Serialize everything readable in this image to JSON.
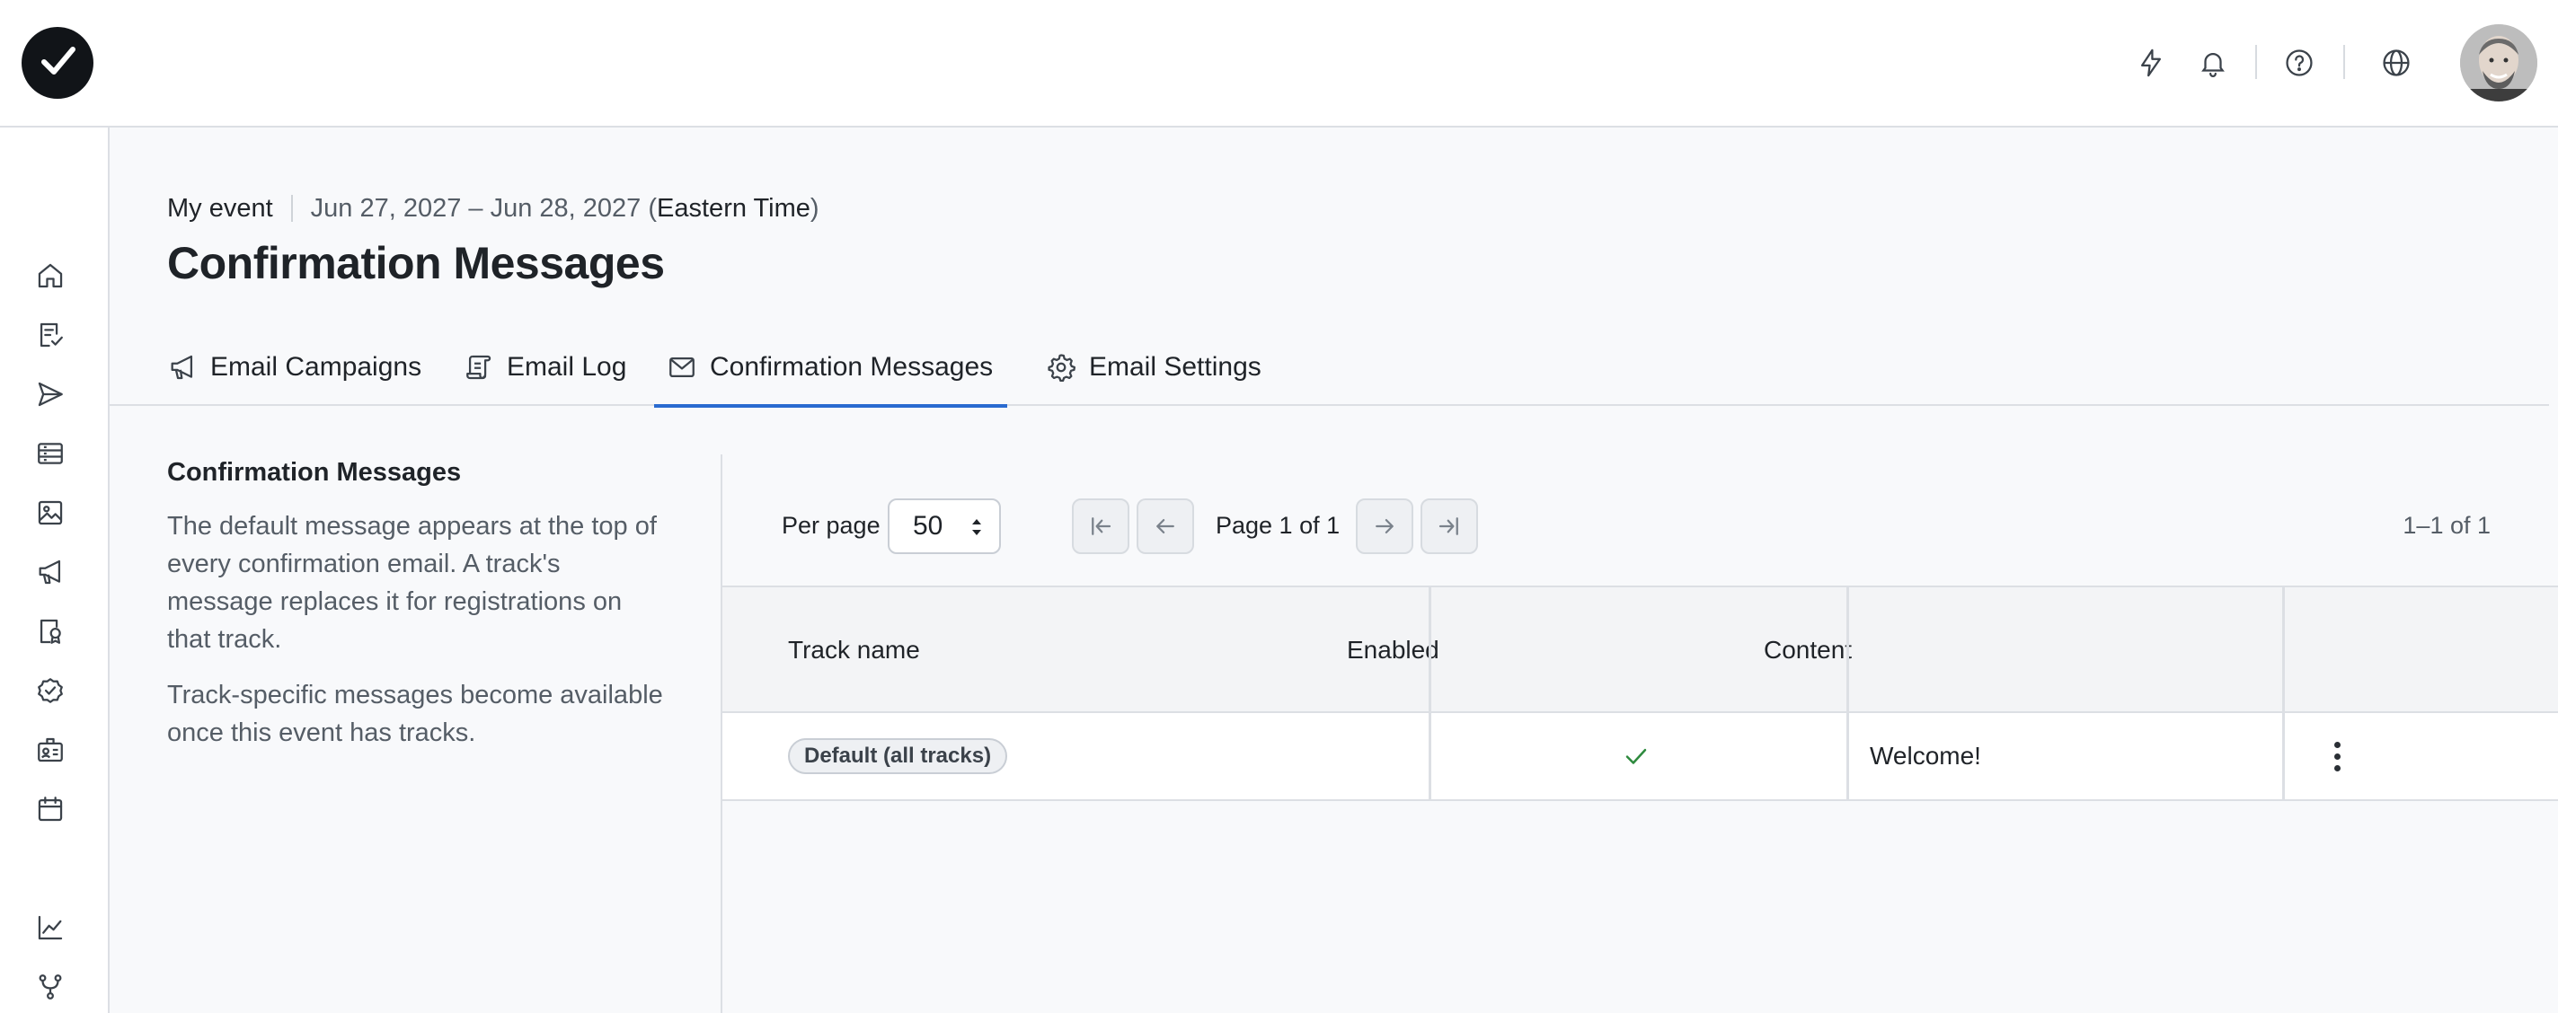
{
  "header": {
    "icons": [
      "lightning-icon",
      "bell-icon",
      "help-icon",
      "globe-icon"
    ]
  },
  "rail": {
    "icons": [
      "home-icon",
      "registration-icon",
      "send-icon",
      "list-icon",
      "image-icon",
      "megaphone-icon",
      "badge-icon",
      "verified-icon",
      "id-card-icon",
      "calendar-icon",
      "analytics-icon",
      "integrations-icon"
    ]
  },
  "event": {
    "name": "My event",
    "dates": "Jun 27, 2027 – Jun 28, 2027 (",
    "timezone": "Eastern Time",
    "tz_close": ")"
  },
  "page": {
    "title": "Confirmation Messages"
  },
  "tabs": [
    {
      "label": "Email Campaigns",
      "icon": "megaphone-icon"
    },
    {
      "label": "Email Log",
      "icon": "scroll-icon"
    },
    {
      "label": "Confirmation Messages",
      "icon": "mail-icon",
      "active": true
    },
    {
      "label": "Email Settings",
      "icon": "gear-icon"
    }
  ],
  "description": {
    "heading": "Confirmation Messages",
    "paragraph1": "The default message appears at the top of every confirmation email. A track's message replaces it for registrations on that track.",
    "paragraph2": "Track-specific messages become available once this event has tracks."
  },
  "pagination": {
    "per_page_label": "Per page",
    "per_page_value": "50",
    "page_info": "Page 1 of 1",
    "range": "1–1 of 1"
  },
  "table": {
    "columns": [
      "Track name",
      "Enabled",
      "Content",
      ""
    ],
    "rows": [
      {
        "track": "Default (all tracks)",
        "enabled": true,
        "content": "Welcome!"
      }
    ]
  },
  "colors": {
    "accent": "#2a6bd0",
    "check": "#2e8a3e"
  }
}
